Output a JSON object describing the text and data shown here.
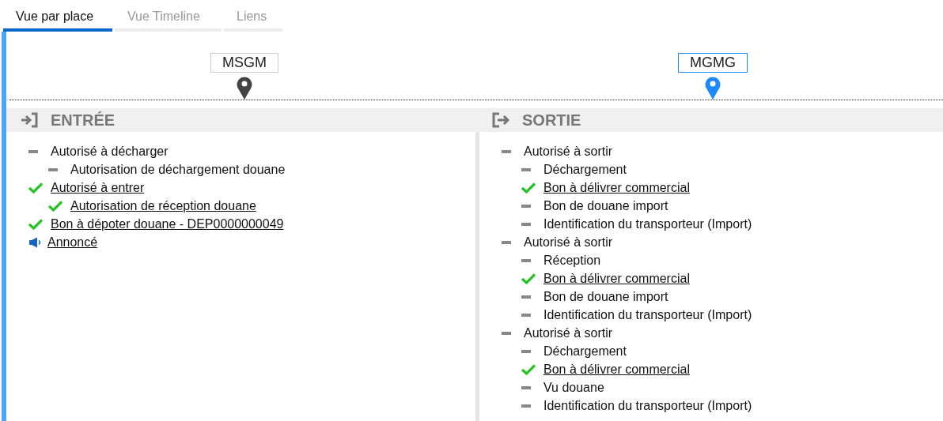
{
  "tabs": [
    {
      "label": "Vue par place",
      "selected": true
    },
    {
      "label": "Vue Timeline",
      "selected": false
    },
    {
      "label": "Liens",
      "selected": false
    }
  ],
  "columns": [
    {
      "place": {
        "label": "MSGM",
        "selected": false
      },
      "heading": {
        "kind": "entry",
        "title": "ENTRÉE"
      },
      "items": [
        {
          "kind": "dash",
          "label": "Autorisé à décharger",
          "link": false,
          "children": [
            {
              "kind": "dash",
              "label": "Autorisation de déchargement douane",
              "link": false
            }
          ]
        },
        {
          "kind": "check",
          "label": "Autorisé à entrer",
          "link": true,
          "children": [
            {
              "kind": "check",
              "label": "Autorisation de réception douane",
              "link": true
            }
          ]
        },
        {
          "kind": "check",
          "label": "Bon à dépoter douane - DEP0000000049",
          "link": true
        },
        {
          "kind": "announce",
          "label": "Annoncé",
          "link": true
        }
      ]
    },
    {
      "place": {
        "label": "MGMG",
        "selected": true
      },
      "heading": {
        "kind": "exit",
        "title": "SORTIE"
      },
      "items": [
        {
          "kind": "dash",
          "label": "Autorisé à sortir",
          "link": false,
          "children": [
            {
              "kind": "dash",
              "label": "Déchargement",
              "link": false
            },
            {
              "kind": "check",
              "label": "Bon à délivrer commercial",
              "link": true
            },
            {
              "kind": "dash",
              "label": "Bon de douane import",
              "link": false
            },
            {
              "kind": "dash",
              "label": "Identification du transporteur (Import)",
              "link": false
            }
          ]
        },
        {
          "kind": "dash",
          "label": "Autorisé à sortir",
          "link": false,
          "children": [
            {
              "kind": "dash",
              "label": "Réception",
              "link": false
            },
            {
              "kind": "check",
              "label": "Bon à délivrer commercial",
              "link": true
            },
            {
              "kind": "dash",
              "label": "Bon de douane import",
              "link": false
            },
            {
              "kind": "dash",
              "label": "Identification du transporteur (Import)",
              "link": false
            }
          ]
        },
        {
          "kind": "dash",
          "label": "Autorisé à sortir",
          "link": false,
          "children": [
            {
              "kind": "dash",
              "label": "Déchargement",
              "link": false
            },
            {
              "kind": "check",
              "label": "Bon à délivrer commercial",
              "link": true
            },
            {
              "kind": "dash",
              "label": "Vu douane",
              "link": false
            },
            {
              "kind": "dash",
              "label": "Identification du transporteur (Import)",
              "link": false
            }
          ]
        }
      ]
    }
  ]
}
